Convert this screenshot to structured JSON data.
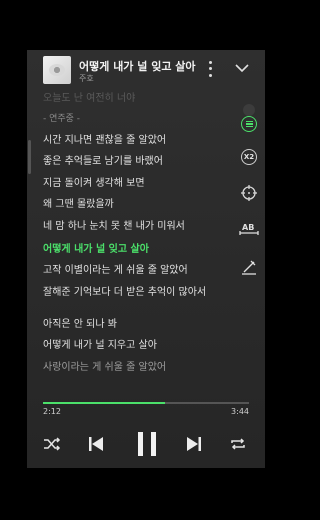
{
  "player": {
    "song_title": "어떻게 내가 널 잊고 살아",
    "artist": "주호"
  },
  "lyrics": [
    {
      "text": "오늘도 난 여전히 너야",
      "state": "faded"
    },
    {
      "text": "- 연주중 -",
      "state": "dim"
    },
    {
      "text": "시간 지나면 괜찮을 줄 알았어",
      "state": "normal"
    },
    {
      "text": "좋은 추억들로 남기를 바랬어",
      "state": "normal"
    },
    {
      "text": "지금 돌이켜 생각해 보면",
      "state": "normal"
    },
    {
      "text": "왜 그땐 몰랐을까",
      "state": "normal"
    },
    {
      "text": "네 맘 하나 눈치 못 챈 내가 미워서",
      "state": "normal"
    },
    {
      "text": "어떻게 내가 널 잊고 살아",
      "state": "active"
    },
    {
      "text": "고작 이별이라는 게 쉬울 줄 알았어",
      "state": "normal"
    },
    {
      "text": "잘해준 기억보다 더 받은 추억이 많아서",
      "state": "normal"
    },
    {
      "text": "아직은 안 되나 봐",
      "state": "normal"
    },
    {
      "text": "어떻게 내가 널 지우고 살아",
      "state": "normal"
    },
    {
      "text": "사랑이라는 게 쉬울 줄 알았어",
      "state": "fading"
    }
  ],
  "tools": {
    "speed_label": "X2"
  },
  "playback": {
    "elapsed": "2:12",
    "total": "3:44",
    "progress_fraction": 0.59
  },
  "colors": {
    "accent": "#4be06a",
    "background": "#2c2c2c"
  },
  "icons": [
    "album-art",
    "more-vertical-icon",
    "chevron-down-icon",
    "lyrics-toggle-icon",
    "speed-icon",
    "crosshair-icon",
    "ab-repeat-icon",
    "pen-icon",
    "shuffle-icon",
    "previous-icon",
    "pause-icon",
    "next-icon",
    "repeat-icon"
  ]
}
